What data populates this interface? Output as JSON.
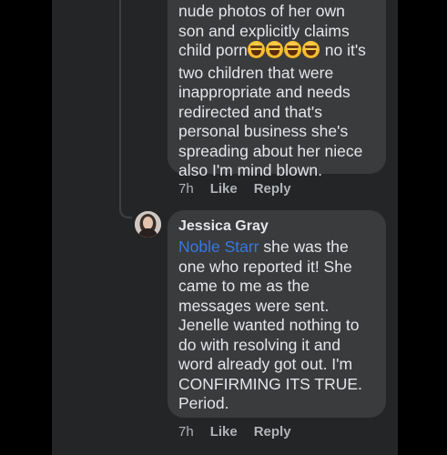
{
  "comment_top": {
    "text": "nude photos of her own\nson and explicitly claims\nchild porn",
    "text_after": " no it's\ntwo children that were\ninappropriate and needs\nredirected and that's\npersonal business she's\nspreading about her niece\nalso I'm mind blown.",
    "emoji_icon": "grinning-squinting-face-icon",
    "time": "7h",
    "like_label": "Like",
    "reply_label": "Reply"
  },
  "comment_bottom": {
    "author": "Jessica Gray",
    "mention": "Noble Starr",
    "text": " she was the\none who reported it! She\ncame to me as the\nmessages were sent.\nJenelle wanted nothing to\ndo with resolving it and\nword already got out. I'm\nCONFIRMING ITS TRUE.\nPeriod.",
    "time": "7h",
    "like_label": "Like",
    "reply_label": "Reply"
  },
  "colors": {
    "background": "#000000",
    "panel": "#242526",
    "bubble": "#3a3b3c",
    "text": "#e4e6eb",
    "meta": "#b0b3b8",
    "mention": "#3578e5"
  }
}
